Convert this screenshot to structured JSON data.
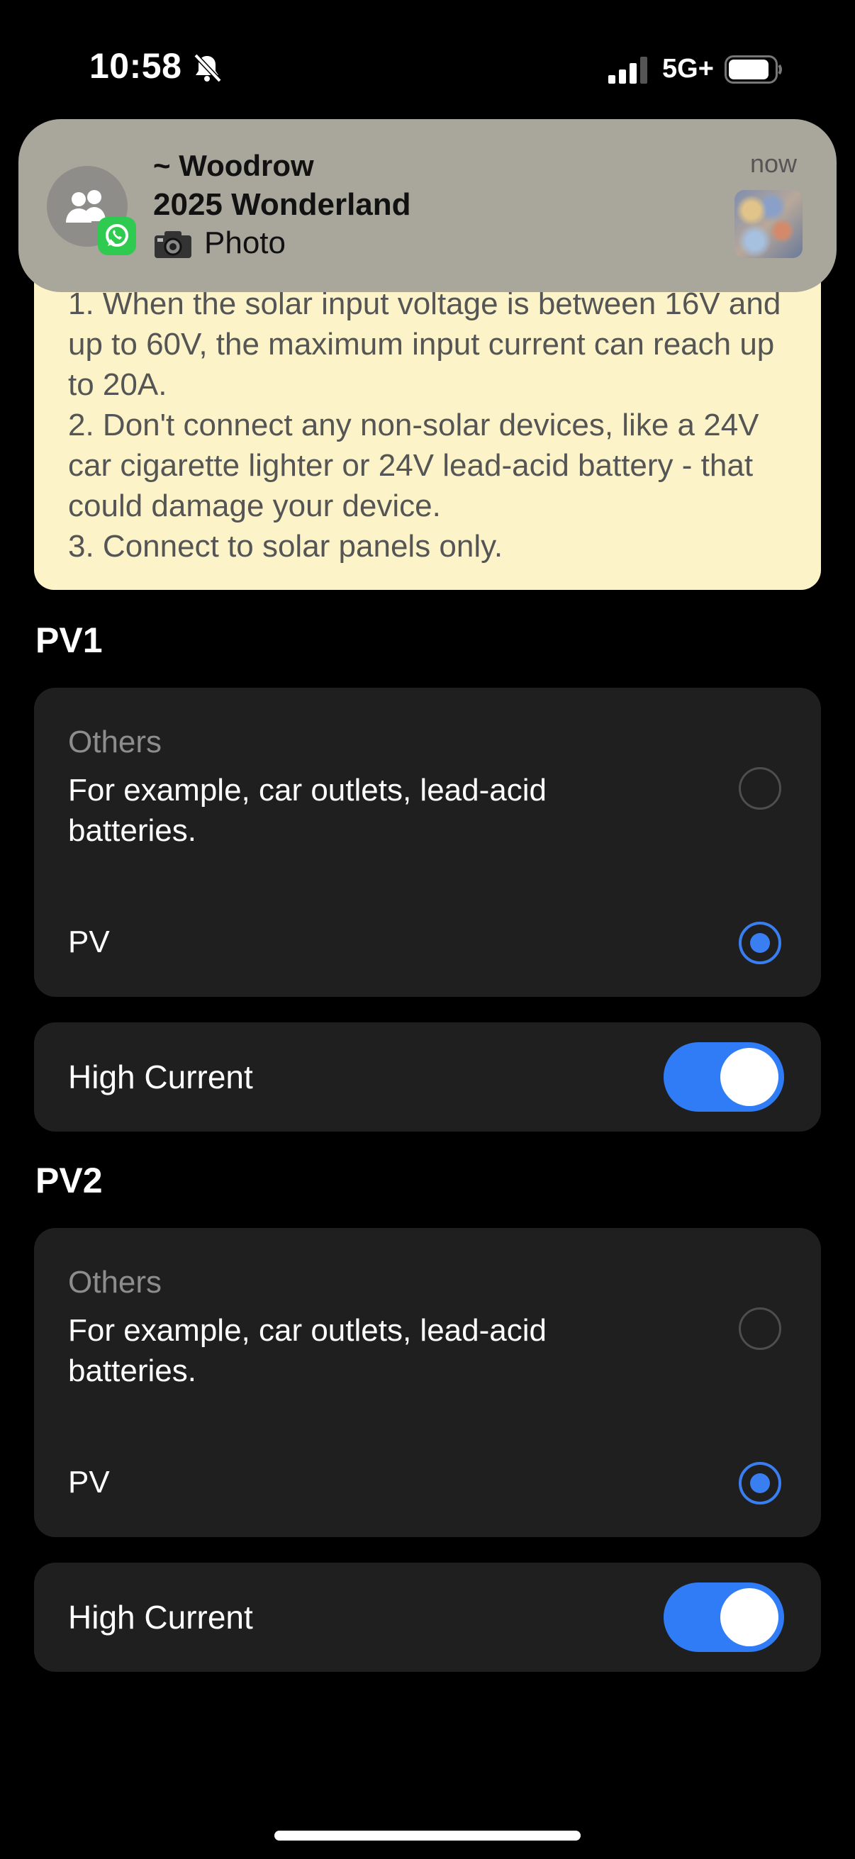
{
  "status_bar": {
    "time": "10:58",
    "network": "5G+"
  },
  "notification": {
    "sender": "~ Woodrow",
    "group": "2025 Wonderland",
    "body": "Photo",
    "time": "now",
    "app_icon": "whatsapp-icon"
  },
  "info": {
    "lines": [
      "1. When the solar input voltage is between 16V and up to 60V, the maximum input current can reach up to 20A.",
      "2. Don't connect any non-solar devices, like a 24V car cigarette lighter or 24V lead-acid battery - that could damage your device.",
      "3. Connect to solar panels only."
    ]
  },
  "pv1": {
    "title": "PV1",
    "others_title": "Others",
    "others_desc": "For example, car outlets, lead-acid batteries.",
    "pv_label": "PV",
    "selected": "PV",
    "high_current_label": "High Current",
    "high_current_on": true
  },
  "pv2": {
    "title": "PV2",
    "others_title": "Others",
    "others_desc": "For example, car outlets, lead-acid batteries.",
    "pv_label": "PV",
    "selected": "PV",
    "high_current_label": "High Current",
    "high_current_on": true
  },
  "colors": {
    "accent": "#2f7cf6",
    "info_bg": "#fcf4c8",
    "card_bg": "#1f1f1f"
  }
}
